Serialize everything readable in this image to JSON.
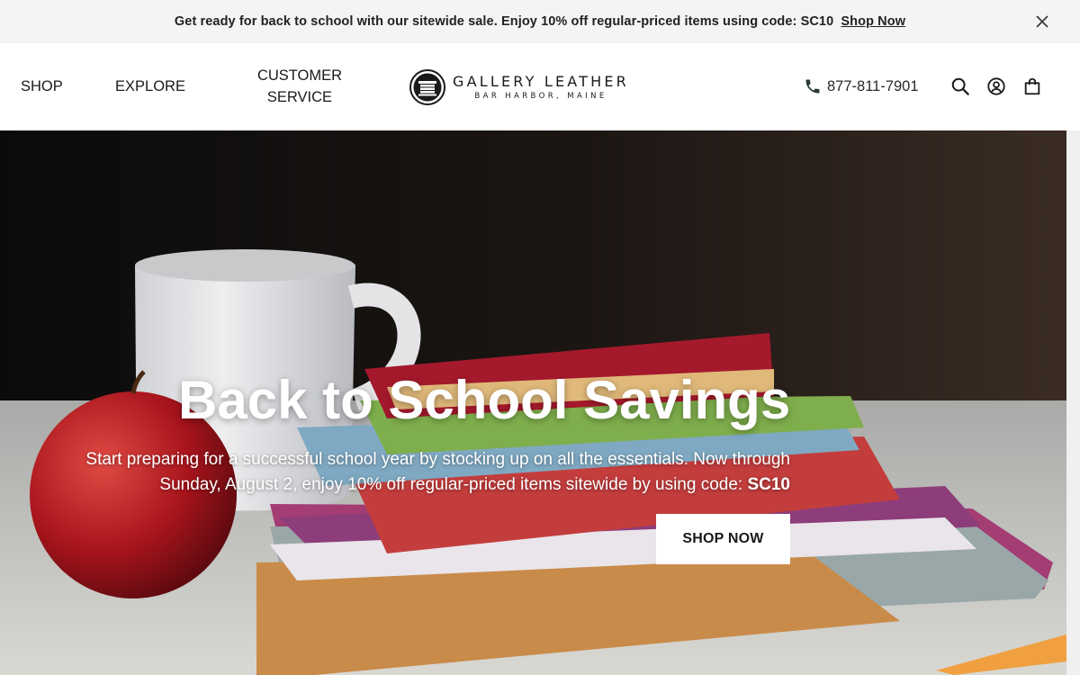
{
  "announcement": {
    "text": "Get ready for back to school with our sitewide sale. Enjoy 10% off regular-priced items using code: SC10",
    "link_label": "Shop Now"
  },
  "nav": {
    "shop": "SHOP",
    "explore": "EXPLORE",
    "customer_service_line1": "CUSTOMER",
    "customer_service_line2": "SERVICE"
  },
  "logo": {
    "name": "GALLERY LEATHER",
    "location": "BAR HARBOR, MAINE"
  },
  "phone": "877-811-7901",
  "icons": {
    "close": "close-icon",
    "phone": "phone-icon",
    "search": "search-icon",
    "account": "account-icon",
    "cart": "shopping-bag-icon"
  },
  "hero": {
    "title": "Back to School Savings",
    "description_line1": "Start preparing for a successful school year by stocking up on all the essentials. Now through",
    "description_line2": "Sunday, August 2, enjoy 10% off regular-priced items sitewide by using code:",
    "code": "SC10",
    "button_label": "SHOP NOW"
  },
  "colors": {
    "announcement_bg": "#f4f4f4",
    "text": "#1a1a1a",
    "button_bg": "#ffffff"
  }
}
